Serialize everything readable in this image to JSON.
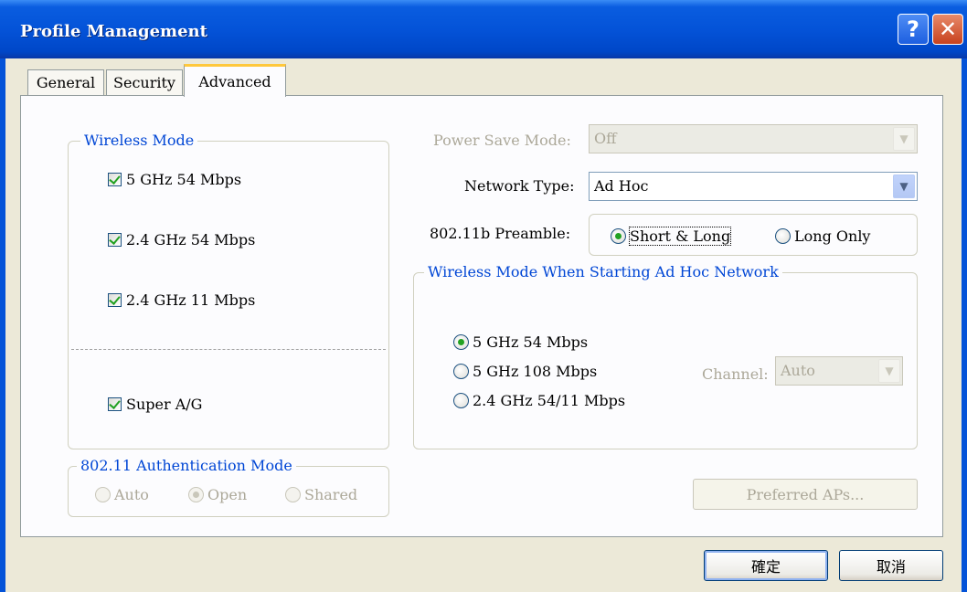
{
  "window": {
    "title": "Profile Management"
  },
  "tabs": [
    {
      "label": "General",
      "active": false
    },
    {
      "label": "Security",
      "active": false
    },
    {
      "label": "Advanced",
      "active": true
    }
  ],
  "wireless_mode": {
    "legend": "Wireless Mode",
    "options": [
      {
        "label": "5 GHz 54 Mbps",
        "checked": true
      },
      {
        "label": "2.4 GHz 54 Mbps",
        "checked": true
      },
      {
        "label": "2.4 GHz 11 Mbps",
        "checked": true
      }
    ],
    "super_ag": {
      "label": "Super A/G",
      "checked": true
    }
  },
  "auth_mode": {
    "legend": "802.11 Authentication Mode",
    "options": [
      {
        "label": "Auto",
        "selected": false
      },
      {
        "label": "Open",
        "selected": true
      },
      {
        "label": "Shared",
        "selected": false
      }
    ]
  },
  "power_save": {
    "label": "Power Save Mode:",
    "value": "Off",
    "enabled": false
  },
  "network_type": {
    "label": "Network Type:",
    "value": "Ad Hoc"
  },
  "preamble": {
    "label": "802.11b Preamble:",
    "options": [
      {
        "label": "Short & Long",
        "selected": true
      },
      {
        "label": "Long Only",
        "selected": false
      }
    ]
  },
  "adhoc_mode": {
    "legend": "Wireless Mode When Starting Ad Hoc Network",
    "options": [
      {
        "label": "5 GHz 54 Mbps",
        "selected": true
      },
      {
        "label": "5 GHz 108 Mbps",
        "selected": false
      },
      {
        "label": "2.4 GHz 54/11 Mbps",
        "selected": false
      }
    ],
    "channel": {
      "label": "Channel:",
      "value": "Auto",
      "enabled": false
    }
  },
  "preferred_aps": {
    "label": "Preferred APs...",
    "enabled": false
  },
  "footer": {
    "ok_label": "確定",
    "cancel_label": "取消"
  },
  "colors": {
    "titlebar": "#0453d8",
    "dialog_bg": "#ece9d8",
    "legend": "#0046d5",
    "check": "#21a121"
  }
}
